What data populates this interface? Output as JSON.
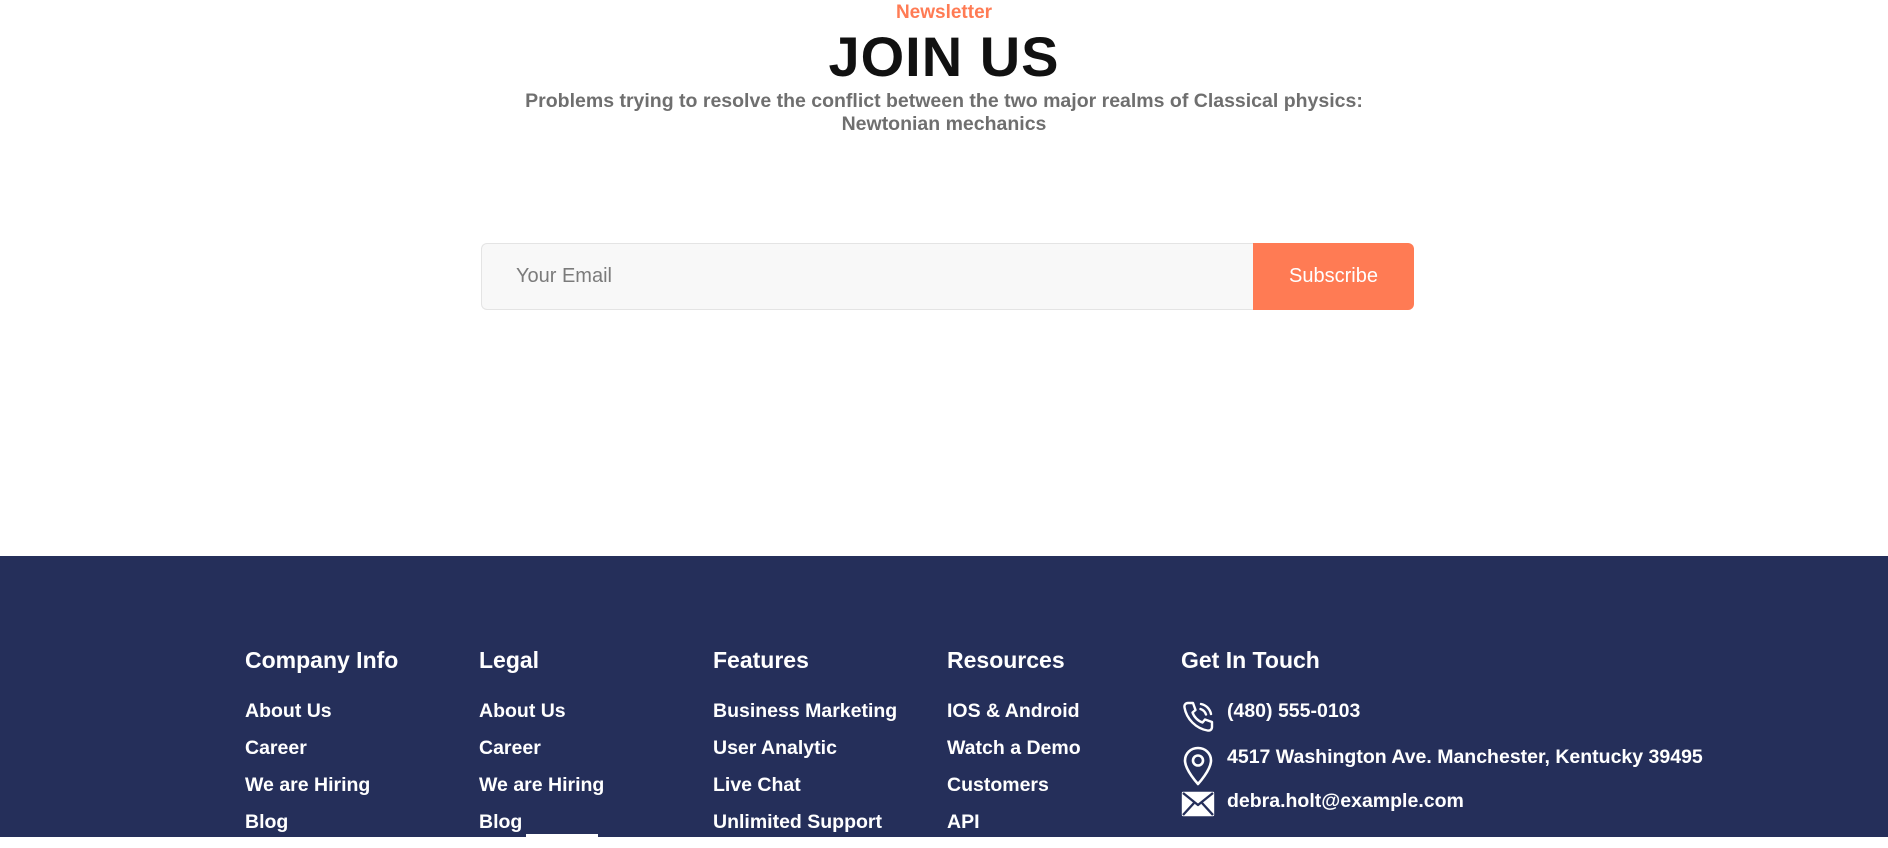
{
  "newsletter": {
    "eyebrow": "Newsletter",
    "title": "JOIN US",
    "subtitle": "Problems trying to resolve the conflict between the two major realms of Classical physics: Newtonian mechanics",
    "email_placeholder": "Your Email",
    "email_value": "",
    "subscribe_label": "Subscribe"
  },
  "colors": {
    "accent": "#FF7B54",
    "footer_bg": "#252F5A"
  },
  "footer": {
    "company": {
      "heading": "Company Info",
      "items": [
        "About Us",
        "Career",
        "We are Hiring",
        "Blog"
      ]
    },
    "legal": {
      "heading": "Legal",
      "items": [
        "About Us",
        "Career",
        "We are Hiring",
        "Blog"
      ]
    },
    "features": {
      "heading": "Features",
      "items": [
        "Business Marketing",
        "User Analytic",
        "Live Chat",
        "Unlimited Support"
      ]
    },
    "resources": {
      "heading": "Resources",
      "items": [
        "IOS & Android",
        "Watch a Demo",
        "Customers",
        "API"
      ]
    },
    "contact": {
      "heading": "Get In Touch",
      "phone": "(480) 555-0103",
      "address": "4517 Washington Ave. Manchester, Kentucky 39495",
      "email": "debra.holt@example.com",
      "icons": [
        "phone-icon",
        "location-pin-icon",
        "mail-icon"
      ]
    }
  }
}
